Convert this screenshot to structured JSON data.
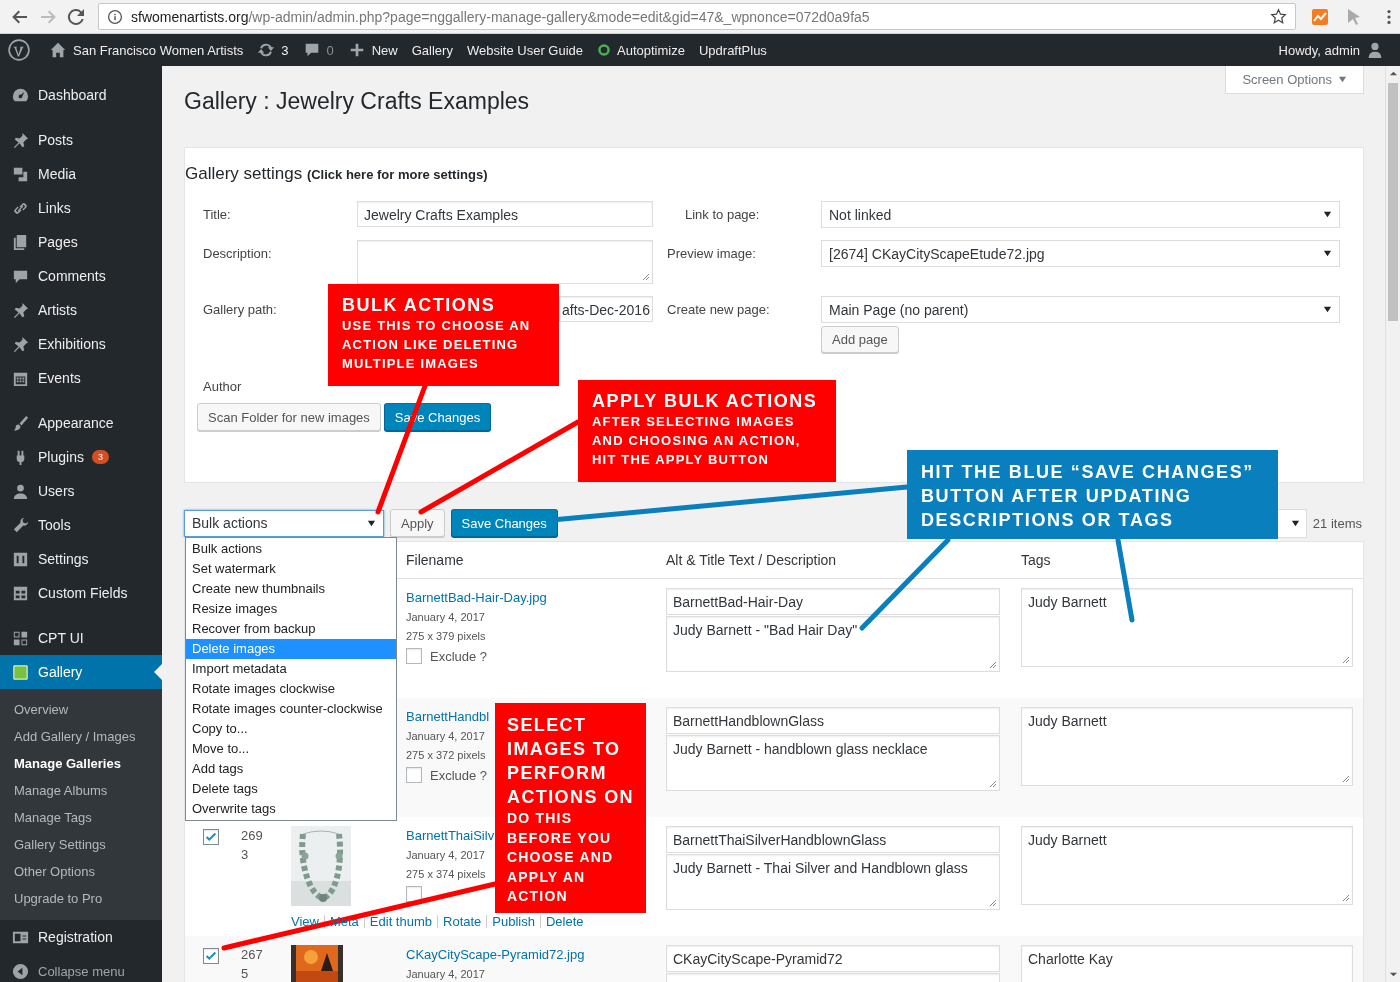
{
  "browser": {
    "url_host": "sfwomenartists.org",
    "url_path": "/wp-admin/admin.php?page=nggallery-manage-gallery&mode=edit&gid=47&_wpnonce=072d0a9fa5"
  },
  "admin_bar": {
    "items": [
      {
        "kind": "home",
        "label": "San Francisco Women Artists"
      },
      {
        "kind": "updates",
        "label": "3"
      },
      {
        "kind": "comments",
        "label": "0"
      },
      {
        "kind": "new",
        "label": "New"
      },
      {
        "kind": "plain",
        "label": "Gallery"
      },
      {
        "kind": "plain",
        "label": "Website User Guide"
      },
      {
        "kind": "status",
        "label": "Autoptimize"
      },
      {
        "kind": "plain",
        "label": "UpdraftPlus"
      }
    ],
    "account": "Howdy, admin"
  },
  "sidebar": {
    "groups": [
      [
        {
          "label": "Dashboard",
          "selected": false
        }
      ],
      [
        {
          "label": "Posts",
          "selected": false
        },
        {
          "label": "Media",
          "selected": false
        },
        {
          "label": "Links",
          "selected": false
        },
        {
          "label": "Pages",
          "selected": false
        },
        {
          "label": "Comments",
          "selected": false
        },
        {
          "label": "Artists",
          "selected": false
        },
        {
          "label": "Exhibitions",
          "selected": false
        },
        {
          "label": "Events",
          "selected": false
        }
      ],
      [
        {
          "label": "Appearance",
          "selected": false
        },
        {
          "label": "Plugins",
          "selected": false,
          "badge": "3"
        },
        {
          "label": "Users",
          "selected": false
        },
        {
          "label": "Tools",
          "selected": false
        },
        {
          "label": "Settings",
          "selected": false
        },
        {
          "label": "Custom Fields",
          "selected": false
        }
      ],
      [
        {
          "label": "CPT UI",
          "selected": false
        },
        {
          "label": "Gallery",
          "selected": true
        }
      ]
    ],
    "submenu": [
      {
        "label": "Overview",
        "selected": false
      },
      {
        "label": "Add Gallery / Images",
        "selected": false
      },
      {
        "label": "Manage Galleries",
        "selected": true
      },
      {
        "label": "Manage Albums",
        "selected": false
      },
      {
        "label": "Manage Tags",
        "selected": false
      },
      {
        "label": "Gallery Settings",
        "selected": false
      },
      {
        "label": "Other Options",
        "selected": false
      },
      {
        "label": "Upgrade to Pro",
        "selected": false
      }
    ],
    "bottom": [
      {
        "label": "Registration",
        "selected": false
      },
      {
        "label": "Collapse menu",
        "selected": false
      }
    ]
  },
  "page": {
    "title": "Gallery : Jewelry Crafts Examples",
    "screen_options": "Screen Options"
  },
  "settings": {
    "heading": "Gallery settings",
    "heading_note": "(Click here for more settings)",
    "title_label": "Title:",
    "title_value": "Jewelry Crafts Examples",
    "link_label": "Link to page:",
    "link_value": "Not linked",
    "description_label": "Description:",
    "preview_label": "Preview image:",
    "preview_value": "[2674] CKayCityScapeEtude72.jpg",
    "path_label": "Gallery path:",
    "path_value": "afts-Dec-2016",
    "create_label": "Create new page:",
    "create_value": "Main Page (no parent)",
    "add_page": "Add page",
    "author_label": "Author",
    "buttons": [
      "Scan Folder for new images",
      "Save Changes"
    ]
  },
  "bulk": {
    "select_value": "Bulk actions",
    "expanded": true,
    "apply": "Apply",
    "save": "Save Changes",
    "count": "21 items",
    "options": [
      {
        "label": "Bulk actions",
        "selected": false
      },
      {
        "label": "Set watermark",
        "selected": false
      },
      {
        "label": "Create new thumbnails",
        "selected": false
      },
      {
        "label": "Resize images",
        "selected": false
      },
      {
        "label": "Recover from backup",
        "selected": false
      },
      {
        "label": "Delete images",
        "selected": true
      },
      {
        "label": "Import metadata",
        "selected": false
      },
      {
        "label": "Rotate images clockwise",
        "selected": false
      },
      {
        "label": "Rotate images counter-clockwise",
        "selected": false
      },
      {
        "label": "Copy to...",
        "selected": false
      },
      {
        "label": "Move to...",
        "selected": false
      },
      {
        "label": "Add tags",
        "selected": false
      },
      {
        "label": "Delete tags",
        "selected": false
      },
      {
        "label": "Overwrite tags",
        "selected": false
      }
    ]
  },
  "table": {
    "columns": [
      "Filename",
      "Alt & Title Text / Description",
      "Tags"
    ],
    "rows": [
      {
        "filename": "BarnettBad-Hair-Day.jpg",
        "date": "January 4, 2017",
        "size": "275 x 379 pixels",
        "exclude": false,
        "exclude_label": "Exclude ?",
        "alt": "BarnettBad-Hair-Day",
        "description": "Judy Barnett - \"Bad Hair Day\"",
        "tags": "Judy Barnett"
      },
      {
        "filename": "BarnettHandbl",
        "date": "January 4, 2017",
        "size": "275 x 372 pixels",
        "exclude": false,
        "exclude_label": "Exclude ?",
        "alt": "BarnettHandblownGlass",
        "description": "Judy Barnett - handblown glass necklace",
        "tags": "Judy Barnett"
      },
      {
        "checked": true,
        "id": "269",
        "order": "3",
        "filename": "BarnettThaiSilv",
        "date": "January 4, 2017",
        "size": "275 x 374 pixels",
        "exclude": false,
        "actions": [
          "View",
          "Meta",
          "Edit thumb",
          "Rotate",
          "Publish",
          "Delete"
        ],
        "alt": "BarnettThaiSilverHandblownGlass",
        "description": "Judy Barnett - Thai Silver and Handblown glass",
        "tags": "Judy Barnett"
      },
      {
        "checked": true,
        "id": "267",
        "order": "5",
        "filename": "CKayCityScape-Pyramid72.jpg",
        "date": "January 4, 2017",
        "alt": "CKayCityScape-Pyramid72",
        "tags": "Charlotte Kay"
      }
    ]
  },
  "callouts": [
    {
      "color": "#ff0000",
      "heading": "BULK ACTIONS",
      "body": "USE THIS TO CHOOSE AN ACTION LIKE DELETING MULTIPLE IMAGES"
    },
    {
      "color": "#ff0000",
      "heading": "APPLY BULK ACTIONS",
      "body": "AFTER SELECTING IMAGES AND CHOOSING AN ACTION, HIT THE APPLY BUTTON"
    },
    {
      "color": "#0a7fbd",
      "heading": "HIT THE BLUE “SAVE CHANGES” BUTTON AFTER UPDATING DESCRIPTIONS OR TAGS"
    },
    {
      "color": "#ff0000",
      "heading": "SELECT IMAGES TO PERFORM ACTIONS ON",
      "body": "DO THIS BEFORE YOU CHOOSE AND APPLY AN ACTION"
    }
  ]
}
